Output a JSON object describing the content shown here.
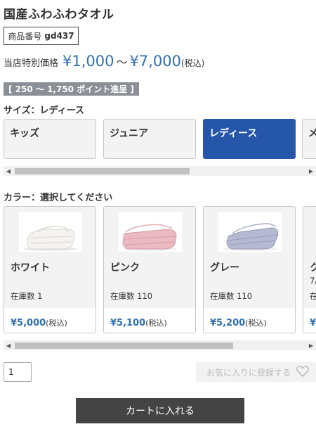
{
  "product": {
    "title": "国産ふわふわタオル",
    "sku_label": "商品番号",
    "sku_code": "gd437",
    "price_label": "当店特別価格",
    "price_min": "¥1,000",
    "price_sep": "～",
    "price_max": "¥7,000",
    "tax_label": "(税込)",
    "points_text": "[ 250 ～ 1,750 ポイント進呈 ]"
  },
  "size": {
    "label": "サイズ：レディース",
    "options": [
      {
        "label": "キッズ",
        "selected": false
      },
      {
        "label": "ジュニア",
        "selected": false
      },
      {
        "label": "レディース",
        "selected": true
      },
      {
        "label": "メ",
        "selected": false
      }
    ]
  },
  "color": {
    "label": "カラー：選択してください",
    "options": [
      {
        "name": "ホワイト",
        "stock": "在庫数 1",
        "price": "¥5,000",
        "tax": "(税込)",
        "swatch": "#eceae6"
      },
      {
        "name": "ピンク",
        "stock": "在庫数 110",
        "price": "¥5,100",
        "tax": "(税込)",
        "swatch": "#e8b8c0"
      },
      {
        "name": "グレー",
        "stock": "在庫数 110",
        "price": "¥5,200",
        "tax": "(税込)",
        "swatch": "#b3b6cf"
      },
      {
        "name": "ク",
        "note": "7/",
        "stock": "在",
        "price": "¥",
        "tax": ""
      }
    ]
  },
  "scrollbars": {
    "size_thumb_fraction": 0.6,
    "color_thumb_fraction": 0.75
  },
  "quantity": {
    "value": "1"
  },
  "favorite": {
    "label": "お気に入りに登録する",
    "icon": "heart-icon"
  },
  "cart": {
    "label": "カートに入れる"
  },
  "colors": {
    "accent": "#2f6fae",
    "selected_size": "#2656a9",
    "points_bg": "#8a9096",
    "cart_bg": "#444444"
  }
}
